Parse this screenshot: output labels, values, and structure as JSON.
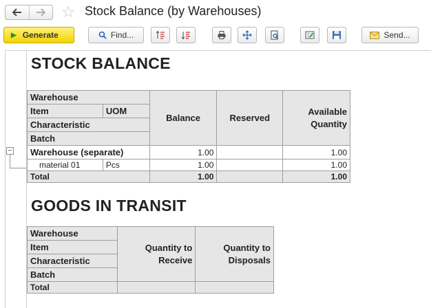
{
  "window": {
    "title": "Stock Balance (by Warehouses)"
  },
  "toolbar": {
    "generate_label": "Generate",
    "find_label": "Find...",
    "send_label": "Send..."
  },
  "report": {
    "stock_balance": {
      "title": "STOCK BALANCE",
      "headers": {
        "warehouse": "Warehouse",
        "item": "Item",
        "uom": "UOM",
        "characteristic": "Characteristic",
        "batch": "Batch",
        "balance": "Balance",
        "reserved": "Reserved",
        "available_line1": "Available",
        "available_line2": "Quantity"
      },
      "group_row": {
        "name": "Warehouse (separate)",
        "balance": "1.00",
        "reserved": "",
        "available": "1.00"
      },
      "detail_row": {
        "item": "material 01",
        "uom": "Pcs",
        "balance": "1.00",
        "reserved": "",
        "available": "1.00"
      },
      "total_row": {
        "label": "Total",
        "balance": "1.00",
        "reserved": "",
        "available": "1.00"
      }
    },
    "goods_in_transit": {
      "title": "GOODS IN TRANSIT",
      "headers": {
        "warehouse": "Warehouse",
        "item": "Item",
        "characteristic": "Characteristic",
        "batch": "Batch",
        "qty_receive_line1": "Quantity to",
        "qty_receive_line2": "Receive",
        "qty_disposals_line1": "Quantity to",
        "qty_disposals_line2": "Disposals"
      },
      "total_row": {
        "label": "Total",
        "qty_receive": "",
        "qty_disposals": ""
      }
    }
  },
  "icons": {
    "back": "back-arrow-icon",
    "forward": "forward-arrow-icon",
    "favorite": "star-icon",
    "generate": "play-icon",
    "find": "search-icon",
    "expand_groups": "expand-groups-icon",
    "collapse_groups": "collapse-groups-icon",
    "print": "printer-icon",
    "move": "move-icon",
    "preview": "print-preview-icon",
    "edit": "edit-report-icon",
    "save": "floppy-disk-icon",
    "send": "envelope-icon"
  },
  "colors": {
    "generate_bg": "#f2d400",
    "header_bg": "#e6e6e6"
  }
}
